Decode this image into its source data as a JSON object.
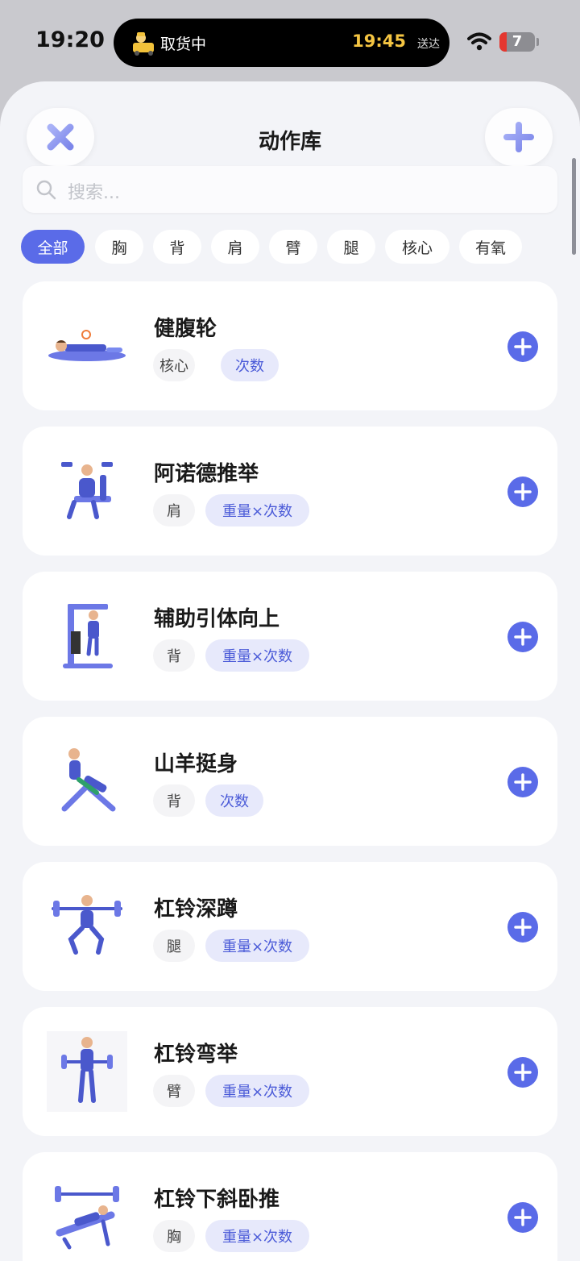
{
  "status_bar": {
    "time": "19:20",
    "activity_status": "取货中",
    "activity_eta": "19:45",
    "activity_eta_label": "送达",
    "battery_level": "7",
    "battery_color": "#e4372f"
  },
  "header": {
    "title": "动作库",
    "close_icon": "close-icon",
    "add_icon": "plus-icon"
  },
  "search": {
    "placeholder": "搜索..."
  },
  "filters": [
    {
      "label": "全部",
      "active": true
    },
    {
      "label": "胸",
      "active": false
    },
    {
      "label": "背",
      "active": false
    },
    {
      "label": "肩",
      "active": false
    },
    {
      "label": "臂",
      "active": false
    },
    {
      "label": "腿",
      "active": false
    },
    {
      "label": "核心",
      "active": false
    },
    {
      "label": "有氧",
      "active": false
    }
  ],
  "exercises": [
    {
      "name": "健腹轮",
      "muscle": "核心",
      "metric": "次数"
    },
    {
      "name": "阿诺德推举",
      "muscle": "肩",
      "metric": "重量×次数"
    },
    {
      "name": "辅助引体向上",
      "muscle": "背",
      "metric": "重量×次数"
    },
    {
      "name": "山羊挺身",
      "muscle": "背",
      "metric": "次数"
    },
    {
      "name": "杠铃深蹲",
      "muscle": "腿",
      "metric": "重量×次数"
    },
    {
      "name": "杠铃弯举",
      "muscle": "臂",
      "metric": "重量×次数"
    },
    {
      "name": "杠铃下斜卧推",
      "muscle": "胸",
      "metric": "重量×次数"
    }
  ],
  "colors": {
    "accent": "#5a6be8",
    "background": "#f3f4f8"
  }
}
